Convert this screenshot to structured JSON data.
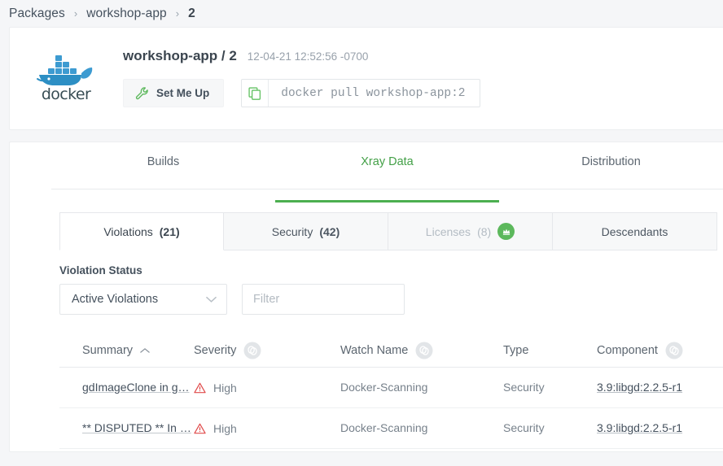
{
  "breadcrumb": {
    "items": [
      {
        "label": "Packages",
        "current": false
      },
      {
        "label": "workshop-app",
        "current": false
      },
      {
        "label": "2",
        "current": true
      }
    ],
    "separator": "›"
  },
  "package": {
    "logo_alt": "docker",
    "logo_wordmark": "docker",
    "title": "workshop-app / 2",
    "timestamp": "12-04-21 12:52:56 -0700",
    "set_me_up_label": "Set Me Up",
    "pull_command": "docker pull workshop-app:2",
    "wrench_icon": "wrench-icon",
    "copy_icon": "copy-icon"
  },
  "main_tabs": [
    {
      "label": "Builds",
      "active": false
    },
    {
      "label": "Xray Data",
      "active": true
    },
    {
      "label": "Distribution",
      "active": false
    }
  ],
  "sub_tabs": [
    {
      "label": "Violations",
      "count": "(21)",
      "active": true,
      "disabled": false,
      "badge": null
    },
    {
      "label": "Security",
      "count": "(42)",
      "active": false,
      "disabled": false,
      "badge": null
    },
    {
      "label": "Licenses",
      "count": "(8)",
      "active": false,
      "disabled": true,
      "badge": "crown-badge-icon"
    },
    {
      "label": "Descendants",
      "count": "",
      "active": false,
      "disabled": false,
      "badge": null
    }
  ],
  "filters": {
    "status_label": "Violation Status",
    "status_value": "Active Violations",
    "status_options": [
      "Active Violations"
    ],
    "search_placeholder": "Filter",
    "search_value": "",
    "chevron_icon": "chevron-down-icon"
  },
  "table": {
    "columns": [
      {
        "label": "Summary",
        "sort_icon": "chevron-up-icon",
        "filter_icon": null
      },
      {
        "label": "Severity",
        "sort_icon": null,
        "filter_icon": "filter-icon"
      },
      {
        "label": "Watch Name",
        "sort_icon": null,
        "filter_icon": "filter-icon"
      },
      {
        "label": "Type",
        "sort_icon": null,
        "filter_icon": null
      },
      {
        "label": "Component",
        "sort_icon": null,
        "filter_icon": "filter-icon"
      }
    ],
    "rows": [
      {
        "summary": "gdImageClone in g…",
        "severity": "High",
        "severity_icon": "warning-triangle-icon",
        "watch_name": "Docker-Scanning",
        "type": "Security",
        "component": "3.9:libgd:2.2.5-r1"
      },
      {
        "summary": "** DISPUTED ** In …",
        "severity": "High",
        "severity_icon": "warning-triangle-icon",
        "watch_name": "Docker-Scanning",
        "type": "Security",
        "component": "3.9:libgd:2.2.5-r1"
      }
    ]
  },
  "colors": {
    "accent_green": "#4caf50",
    "severity_high": "#e04b4b",
    "page_bg": "#f5f6f8",
    "text_primary": "#44505c",
    "text_muted": "#8b949d"
  }
}
